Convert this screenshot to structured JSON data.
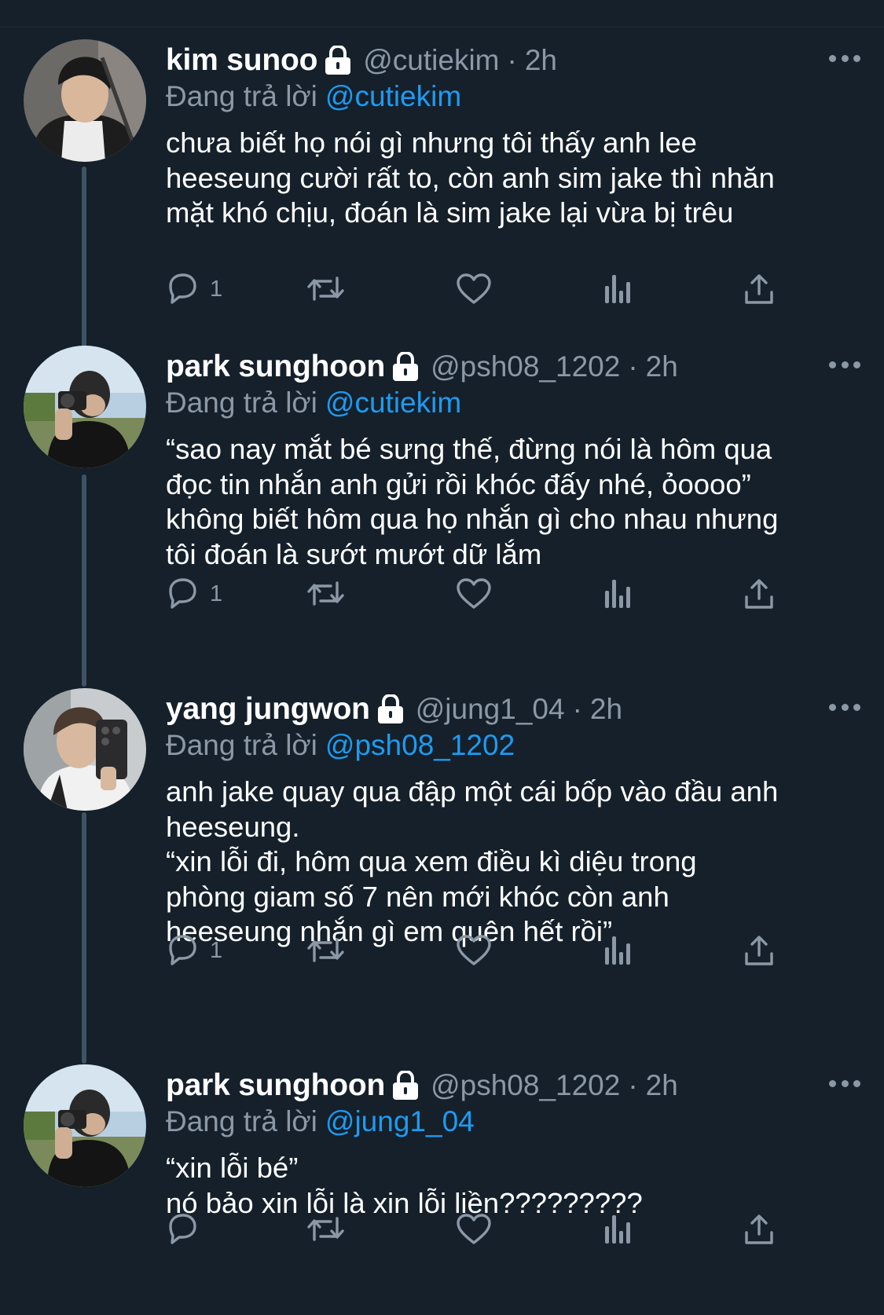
{
  "colors": {
    "background": "#15202b",
    "text_primary": "#ffffff",
    "text_secondary": "#8b98a5",
    "accent_link": "#1d9bf0",
    "thread_line": "#3d5466"
  },
  "tweets": [
    {
      "name": "kim sunoo",
      "handle": "@cutiekim",
      "dot": "·",
      "time": "2h",
      "reply_prefix": "Đang trả lời",
      "reply_to": "@cutiekim",
      "lines": [
        "chưa biết họ nói gì nhưng tôi thấy anh lee",
        "heeseung cười rất to, còn anh sim jake thì nhăn",
        "mặt khó chịu, đoán là sim jake lại vừa bị trêu"
      ],
      "reply_count": "1",
      "icons": [
        "lock-icon",
        "more-icon",
        "reply-icon",
        "retweet-icon",
        "like-icon",
        "views-icon",
        "share-icon"
      ]
    },
    {
      "name": "park sunghoon",
      "handle": "@psh08_1202",
      "dot": "·",
      "time": "2h",
      "reply_prefix": "Đang trả lời",
      "reply_to": "@cutiekim",
      "lines": [
        "“sao nay mắt bé sưng thế, đừng nói là hôm qua",
        "đọc tin nhắn anh gửi rồi khóc đấy nhé, ỏoooo”",
        "không biết hôm qua họ nhắn gì cho nhau nhưng",
        "tôi đoán là sướt mướt dữ lắm"
      ],
      "reply_count": "1",
      "icons": [
        "lock-icon",
        "more-icon",
        "reply-icon",
        "retweet-icon",
        "like-icon",
        "views-icon",
        "share-icon"
      ]
    },
    {
      "name": "yang jungwon",
      "handle": "@jung1_04",
      "dot": "·",
      "time": "2h",
      "reply_prefix": "Đang trả lời",
      "reply_to": "@psh08_1202",
      "lines": [
        "anh jake quay qua đập một cái bốp vào đầu anh",
        "heeseung.",
        "“xin lỗi đi, hôm qua xem điều kì diệu trong",
        "phòng giam số 7 nên mới khóc còn anh",
        "heeseung nhắn gì em quên hết rồi”"
      ],
      "reply_count": "1",
      "icons": [
        "lock-icon",
        "more-icon",
        "reply-icon",
        "retweet-icon",
        "like-icon",
        "views-icon",
        "share-icon"
      ]
    },
    {
      "name": "park sunghoon",
      "handle": "@psh08_1202",
      "dot": "·",
      "time": "2h",
      "reply_prefix": "Đang trả lời",
      "reply_to": "@jung1_04",
      "lines": [
        "“xin lỗi bé”",
        "nó bảo xin lỗi là xin lỗi liền?????????"
      ],
      "reply_count": "",
      "icons": [
        "lock-icon",
        "more-icon",
        "reply-icon",
        "retweet-icon",
        "like-icon",
        "views-icon",
        "share-icon"
      ]
    }
  ]
}
